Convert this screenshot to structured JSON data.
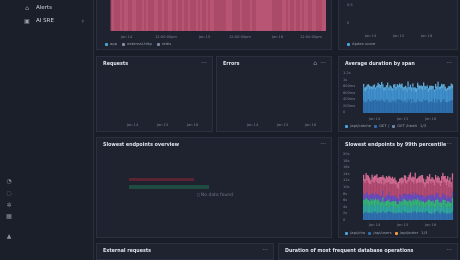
{
  "sidebar": {
    "items": [
      {
        "label": "Alerts",
        "icon": "bell-icon"
      },
      {
        "label": "AI SRE",
        "icon": "ai-icon"
      }
    ]
  },
  "top_left_panel": {
    "legend": [
      "app",
      "external-http",
      "redis"
    ],
    "legend_colors": [
      "#4aa3d9",
      "#8a8fa0",
      "#7e8ba3"
    ],
    "x_ticks": [
      "Jan 14",
      "12:00:00pm",
      "Jan 15",
      "12:00:00pm",
      "Jan 16",
      "12:00:00pm"
    ]
  },
  "top_right_panel": {
    "y_ticks": [
      "0.5",
      "0"
    ],
    "x_ticks": [
      "Jan 14",
      "Jan 15",
      "Jan 16"
    ],
    "legend": [
      "Apdex score"
    ],
    "legend_colors": [
      "#4aa3d9"
    ]
  },
  "requests": {
    "title": "Requests",
    "x_ticks": [
      "Jan 14",
      "Jan 15",
      "Jan 16"
    ]
  },
  "errors": {
    "title": "Errors",
    "x_ticks": [
      "Jan 14",
      "Jan 15",
      "Jan 16"
    ]
  },
  "avg_duration": {
    "title": "Average duration by span",
    "y_ticks": [
      "1.2s",
      "1s",
      "800ms",
      "600ms",
      "400ms",
      "200ms",
      "0"
    ],
    "x_ticks": [
      "Jan 14",
      "Jan 15",
      "Jan 16"
    ],
    "legend": [
      "/api/catche",
      "GET /",
      "GET /healt",
      "1/3"
    ],
    "legend_colors": [
      "#4aa3d9",
      "#2f6fb0",
      "#6f86a8"
    ]
  },
  "slowest_overview": {
    "title": "Slowest endpoints overview",
    "no_data": "No data found"
  },
  "p99": {
    "title": "Slowest endpoints by 99th percentile",
    "y_ticks": [
      "20s",
      "18s",
      "16s",
      "14s",
      "12s",
      "10s",
      "8s",
      "6s",
      "4s",
      "2s",
      "0"
    ],
    "x_ticks": [
      "Jan 14",
      "Jan 15",
      "Jan 16"
    ],
    "legend": [
      "/api/cha",
      "/api/users",
      "/api/order",
      "1/3"
    ],
    "legend_colors": [
      "#4aa3d9",
      "#2f6fb0",
      "#e8a23c"
    ]
  },
  "external_requests": {
    "title": "External requests"
  },
  "db_ops": {
    "title": "Duration of most frequent database operations"
  },
  "menu_glyph": "···",
  "bottom_icons": [
    "bell-icon",
    "chat-icon",
    "settings-icon",
    "grid-icon",
    "logo-icon"
  ]
}
